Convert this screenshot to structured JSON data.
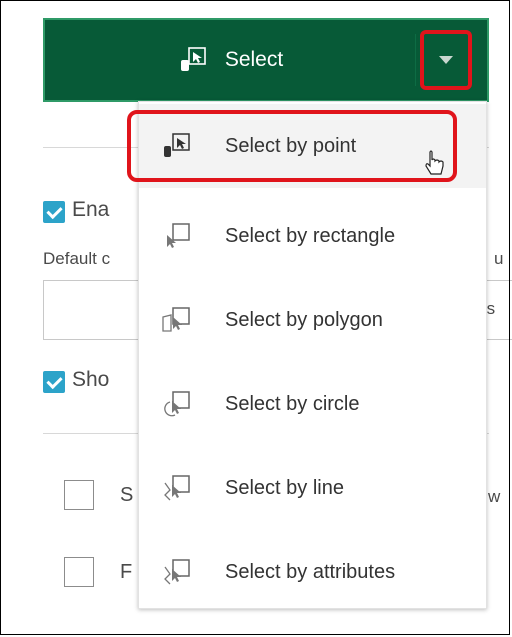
{
  "select_button": {
    "label": "Select",
    "icon": "select-by-point-icon"
  },
  "section1": {
    "enable_label": "Ena",
    "default_label": "Default c",
    "right_fragment_u": "u",
    "right_fragment_rs": "rs",
    "show_label": "Sho"
  },
  "section2": {
    "row1_label_fragment": "S",
    "row1_right_fragment": "w",
    "row2_label_fragment": "F"
  },
  "dropdown": {
    "items": [
      {
        "label": "Select by point",
        "icon": "select-by-point-icon"
      },
      {
        "label": "Select by rectangle",
        "icon": "select-by-rectangle-icon"
      },
      {
        "label": "Select by polygon",
        "icon": "select-by-polygon-icon"
      },
      {
        "label": "Select by circle",
        "icon": "select-by-circle-icon"
      },
      {
        "label": "Select by line",
        "icon": "select-by-line-icon"
      },
      {
        "label": "Select by attributes",
        "icon": "select-by-attributes-icon"
      }
    ]
  },
  "colors": {
    "header_green": "#075a37",
    "highlight_red": "#e0141b",
    "checkbox_blue": "#2ca3c9"
  }
}
